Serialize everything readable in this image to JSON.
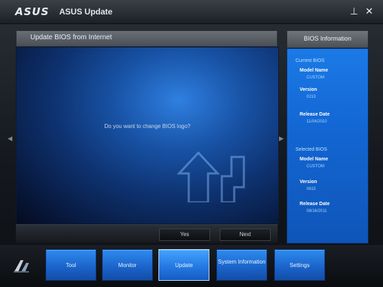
{
  "titlebar": {
    "logo": "ASUS",
    "title": "ASUS Update",
    "pin_glyph": "⊥",
    "close_glyph": "✕"
  },
  "main": {
    "header": "Update BIOS from Internet",
    "prompt": "Do you want to change BIOS logo?",
    "yes_label": "Yes",
    "no_label": "Next"
  },
  "info": {
    "header": "BIOS Information",
    "current": {
      "section": "Current BIOS",
      "model_label": "Model Name",
      "model_value": "CUSTOM",
      "version_label": "Version",
      "version_value": "0213",
      "date_label": "Release Date",
      "date_value": "11/04/2010"
    },
    "selected": {
      "section": "Selected BIOS",
      "model_label": "Model Name",
      "model_value": "CUSTOM",
      "version_label": "Version",
      "version_value": "0615",
      "date_label": "Release Date",
      "date_value": "08/16/2011"
    }
  },
  "nav": {
    "tabs": [
      {
        "label": "Tool"
      },
      {
        "label": "Monitor"
      },
      {
        "label": "Update"
      },
      {
        "label": "System Information"
      },
      {
        "label": "Settings"
      }
    ],
    "active_index": 2
  },
  "colors": {
    "accent": "#1b7ae6",
    "panel_dark": "#0e3270"
  },
  "icons": {
    "pin": "pin-icon",
    "close": "close-icon",
    "brand": "asus-brand-icon"
  }
}
